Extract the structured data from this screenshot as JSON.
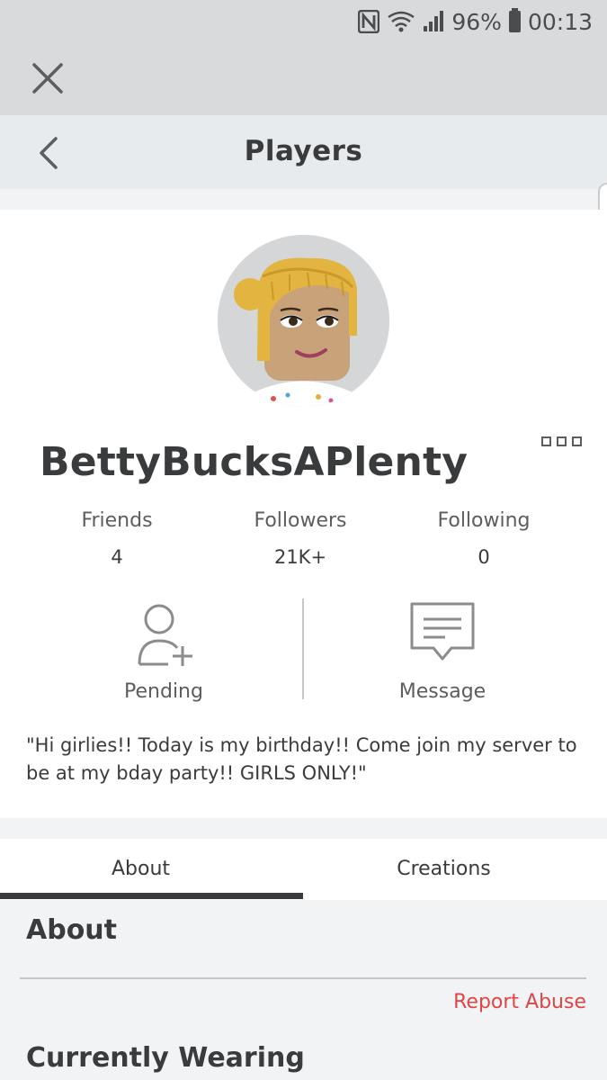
{
  "status_bar": {
    "battery": "96%",
    "time": "00:13"
  },
  "nav": {
    "title": "Players"
  },
  "profile": {
    "username": "BettyBucksAPlenty",
    "stats": [
      {
        "label": "Friends",
        "value": "4"
      },
      {
        "label": "Followers",
        "value": "21K+"
      },
      {
        "label": "Following",
        "value": "0"
      }
    ],
    "actions": {
      "pending": "Pending",
      "message": "Message"
    },
    "bio": "\"Hi girlies!! Today is my birthday!! Come join my server to be at my bday party!! GIRLS ONLY!\""
  },
  "tabs": [
    {
      "label": "About",
      "selected": true
    },
    {
      "label": "Creations",
      "selected": false
    }
  ],
  "about": {
    "heading": "About",
    "report": "Report Abuse",
    "wearing_heading": "Currently Wearing"
  },
  "colors": {
    "accent_red": "#e04545",
    "text": "#393b3d",
    "background": "#f2f3f5"
  }
}
